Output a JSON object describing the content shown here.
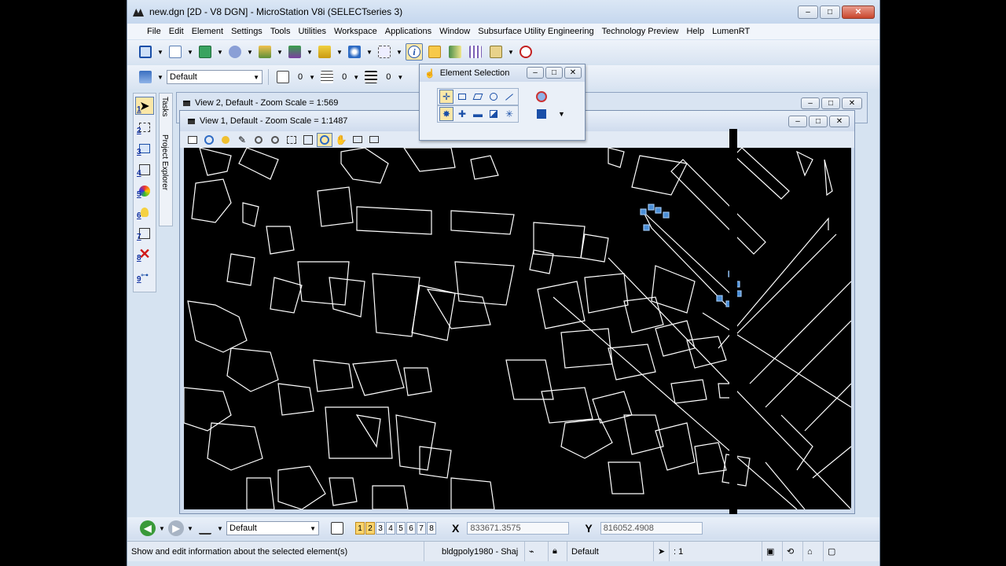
{
  "window": {
    "title": "new.dgn [2D - V8 DGN] - MicroStation V8i (SELECTseries 3)",
    "minimize": "‒",
    "maximize": "□",
    "close": "✕"
  },
  "menu": [
    "File",
    "Edit",
    "Element",
    "Settings",
    "Tools",
    "Utilities",
    "Workspace",
    "Applications",
    "Window",
    "Subsurface Utility Engineering",
    "Technology Preview",
    "Help",
    "LumenRT"
  ],
  "attributes": {
    "level": "Default",
    "color_value": "0",
    "style_value": "0",
    "weight_value": "0"
  },
  "tool_numbers": [
    "1",
    "2",
    "3",
    "4",
    "5",
    "6",
    "7",
    "8",
    "9"
  ],
  "side_tabs": {
    "tasks": "Tasks",
    "project_explorer": "Project Explorer"
  },
  "view2": {
    "title": "View 2, Default - Zoom Scale = 1:569"
  },
  "view1": {
    "title": "View 1, Default - Zoom Scale = 1:1487"
  },
  "element_selection": {
    "title": "Element Selection"
  },
  "bottom": {
    "level_select": "Default",
    "view_numbers": [
      "1",
      "2",
      "3",
      "4",
      "5",
      "6",
      "7",
      "8"
    ],
    "active_views": [
      "1",
      "2"
    ],
    "x_label": "X",
    "x_value": "833671.3575",
    "y_label": "Y",
    "y_value": "816052.4908"
  },
  "status": {
    "prompt": "Show and edit information about the selected element(s)",
    "element": "bldgpoly1980 - Shaj",
    "level": "Default",
    "selection_count": ": 1"
  },
  "colors": {
    "accent_active": "#fbe7a7",
    "selection_handles": "#4a8fd8",
    "canvas_background": "#000000",
    "linework": "#ffffff"
  }
}
